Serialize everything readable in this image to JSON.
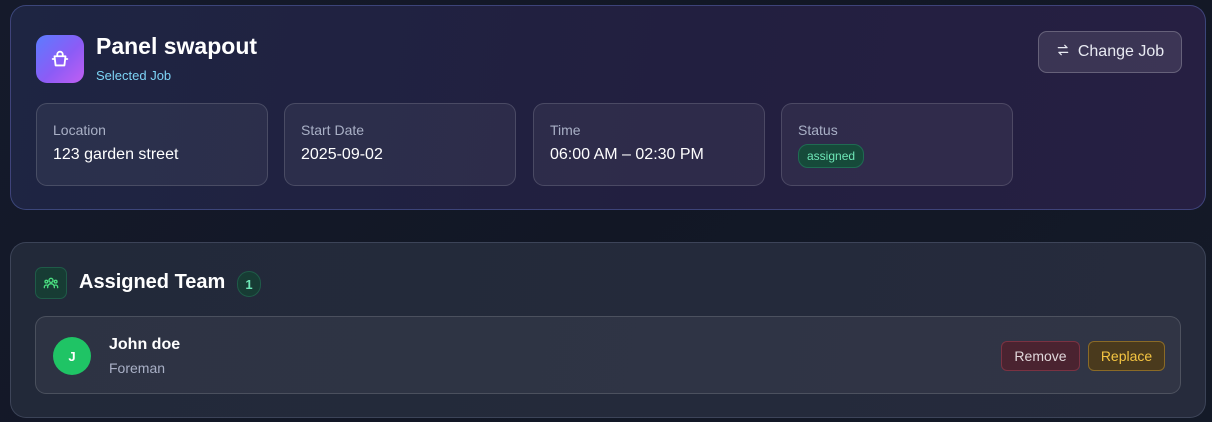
{
  "job": {
    "title": "Panel swapout",
    "subtitle": "Selected Job",
    "icon": "tool-bag-icon",
    "change_button": {
      "label": "Change Job",
      "icon": "swap-arrows-icon"
    },
    "info": [
      {
        "label": "Location",
        "value": "123 garden street"
      },
      {
        "label": "Start Date",
        "value": "2025-09-02"
      },
      {
        "label": "Time",
        "value": "06:00 AM – 02:30 PM"
      },
      {
        "label": "Status",
        "value": "assigned"
      }
    ]
  },
  "team": {
    "title": "Assigned Team",
    "icon": "team-icon",
    "count": "1",
    "members": [
      {
        "initial": "J",
        "name": "John doe",
        "role": "Foreman",
        "remove_label": "Remove",
        "replace_label": "Replace"
      }
    ]
  },
  "colors": {
    "accent_gradient_start": "#5b7cff",
    "accent_gradient_end": "#c15ef2",
    "status_green": "#6ee7b7",
    "avatar_green": "#1fc465",
    "remove_red": "#7a3242",
    "replace_amber": "#f5c542"
  }
}
